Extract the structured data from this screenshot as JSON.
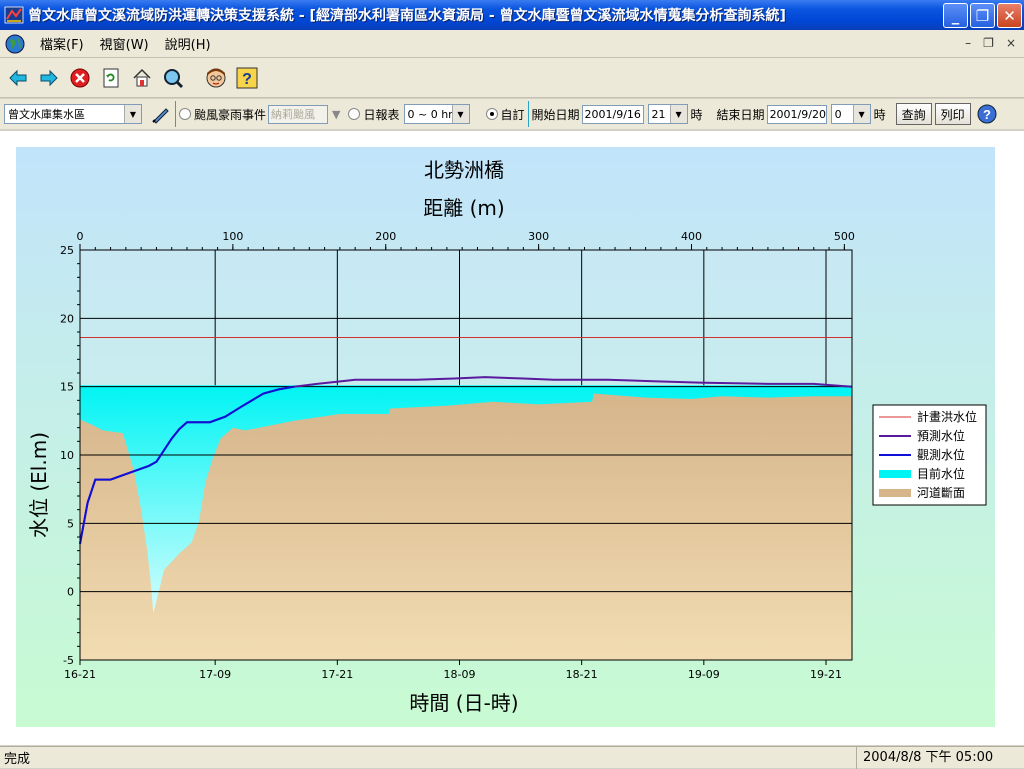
{
  "window": {
    "title": "曾文水庫曾文溪流域防洪運轉決策支援系統 - [經濟部水利署南區水資源局 - 曾文水庫暨曾文溪流域水情蒐集分析查詢系統]",
    "minimize": "_",
    "maximize": "❐",
    "close": "✕"
  },
  "menu": {
    "items": [
      {
        "label": "檔案(F)"
      },
      {
        "label": "視窗(W)"
      },
      {
        "label": "說明(H)"
      }
    ],
    "mdi_min": "–",
    "mdi_restore": "❐",
    "mdi_close": "×"
  },
  "toolbar": {
    "icons": [
      "back-arrow-icon",
      "forward-arrow-icon",
      "stop-icon",
      "refresh-icon",
      "home-icon",
      "search-globe-icon",
      "user-face-icon",
      "help-glasses-icon"
    ]
  },
  "query": {
    "area_select": "曾文水庫集水區",
    "typhoon_label": "颱風豪雨事件",
    "typhoon_value": "納莉颱風",
    "daily_label": "日報表",
    "daily_select": "0 ~ 0 hr",
    "custom_label": "自訂",
    "start_label": "開始日期",
    "start_date": "2001/9/16",
    "start_hour": "21",
    "hour_unit": "時",
    "end_label": "結束日期",
    "end_date": "2001/9/20",
    "end_hour": "0",
    "query_button": "查詢",
    "print_button": "列印"
  },
  "status": {
    "main": "完成",
    "datetime": "2004/8/8  下午 05:00"
  },
  "colors": {
    "flood_line": "#d43030",
    "forecast_line": "#5a1a9e",
    "observed_line": "#1010d8",
    "current_water": "#00f4f4",
    "river_section_top": "#d6b58b",
    "river_section_bottom": "#f2dcb2",
    "bg_top": "#c2e4fb",
    "bg_bottom": "#c8fbd2"
  },
  "chart_data": {
    "type": "line",
    "title": "北勢洲橋",
    "top_axis_label": "距離 (m)",
    "xlabel": "時間 (日-時)",
    "ylabel": "水位 (El.m)",
    "ylim": [
      -5,
      25
    ],
    "yticks": [
      -5,
      0,
      5,
      10,
      15,
      20,
      25
    ],
    "top_xlim": [
      0,
      505
    ],
    "top_xticks": [
      0,
      100,
      200,
      300,
      400,
      500
    ],
    "time_ticks": [
      "16-21",
      "17-09",
      "17-21",
      "18-09",
      "18-21",
      "19-09",
      "19-21"
    ],
    "legend_position": "right",
    "grid": true,
    "series": [
      {
        "name": "計畫洪水位",
        "kind": "line",
        "points": [
          [
            0,
            18.6
          ],
          [
            505,
            18.6
          ]
        ]
      },
      {
        "name": "預測水位",
        "kind": "line",
        "points": [
          [
            0,
            3.5
          ],
          [
            5,
            6.5
          ],
          [
            10,
            8.2
          ],
          [
            20,
            8.2
          ],
          [
            45,
            9.2
          ],
          [
            50,
            9.5
          ],
          [
            60,
            11.2
          ],
          [
            65,
            11.9
          ],
          [
            70,
            12.4
          ],
          [
            85,
            12.4
          ],
          [
            95,
            12.8
          ],
          [
            105,
            13.5
          ],
          [
            120,
            14.5
          ],
          [
            130,
            14.8
          ],
          [
            140,
            15.0
          ],
          [
            155,
            15.2
          ],
          [
            180,
            15.5
          ],
          [
            220,
            15.5
          ],
          [
            245,
            15.6
          ],
          [
            265,
            15.7
          ],
          [
            290,
            15.6
          ],
          [
            310,
            15.5
          ],
          [
            345,
            15.5
          ],
          [
            375,
            15.4
          ],
          [
            405,
            15.3
          ],
          [
            450,
            15.2
          ],
          [
            480,
            15.2
          ],
          [
            505,
            15.0
          ]
        ]
      },
      {
        "name": "觀測水位",
        "kind": "line",
        "points": [
          [
            0,
            3.5
          ],
          [
            5,
            6.5
          ],
          [
            10,
            8.2
          ],
          [
            20,
            8.2
          ],
          [
            45,
            9.2
          ],
          [
            50,
            9.5
          ],
          [
            60,
            11.2
          ],
          [
            65,
            11.9
          ],
          [
            70,
            12.4
          ],
          [
            85,
            12.4
          ],
          [
            95,
            12.8
          ],
          [
            105,
            13.5
          ],
          [
            120,
            14.5
          ],
          [
            130,
            14.8
          ],
          [
            140,
            15.0
          ]
        ]
      },
      {
        "name": "目前水位",
        "kind": "area",
        "level": 15.1
      },
      {
        "name": "河道斷面",
        "kind": "area",
        "points": [
          [
            0,
            12.6
          ],
          [
            8,
            12.2
          ],
          [
            15,
            11.8
          ],
          [
            28,
            11.6
          ],
          [
            35,
            9.0
          ],
          [
            40,
            6.0
          ],
          [
            44,
            3.0
          ],
          [
            46,
            1.0
          ],
          [
            48,
            -1.6
          ],
          [
            55,
            1.6
          ],
          [
            65,
            2.8
          ],
          [
            73,
            3.6
          ],
          [
            78,
            5.2
          ],
          [
            82,
            8.0
          ],
          [
            87,
            9.8
          ],
          [
            92,
            11.2
          ],
          [
            100,
            12.0
          ],
          [
            108,
            11.8
          ],
          [
            122,
            12.1
          ],
          [
            140,
            12.5
          ],
          [
            170,
            13.0
          ],
          [
            202,
            13.0
          ],
          [
            203,
            13.4
          ],
          [
            240,
            13.6
          ],
          [
            270,
            13.9
          ],
          [
            300,
            13.7
          ],
          [
            335,
            13.9
          ],
          [
            336,
            14.5
          ],
          [
            370,
            14.2
          ],
          [
            400,
            14.1
          ],
          [
            420,
            14.3
          ],
          [
            450,
            14.2
          ],
          [
            480,
            14.3
          ],
          [
            505,
            14.3
          ]
        ]
      }
    ]
  }
}
